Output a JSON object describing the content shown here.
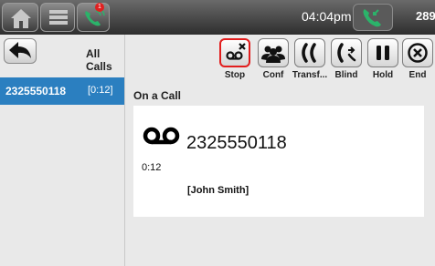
{
  "status_bar": {
    "time": "04:04pm",
    "extension": "289",
    "notification_count": "1",
    "icons": [
      "home-icon",
      "menu-icon",
      "phone-icon",
      "active-call-icon"
    ]
  },
  "left_panel": {
    "back_icon": "back-arrow-icon",
    "title": "All Calls",
    "calls": [
      {
        "number": "2325550118",
        "duration": "[0:12]"
      }
    ]
  },
  "toolbar": {
    "buttons": [
      {
        "label": "Stop",
        "icon": "voicemail-stop-icon",
        "active": true
      },
      {
        "label": "Conf",
        "icon": "conference-icon"
      },
      {
        "label": "Transf...",
        "icon": "transfer-icon"
      },
      {
        "label": "Blind",
        "icon": "blind-transfer-icon"
      },
      {
        "label": "Hold",
        "icon": "hold-icon"
      },
      {
        "label": "End",
        "icon": "end-call-icon"
      }
    ]
  },
  "main": {
    "status": "On a Call",
    "card": {
      "number": "2325550118",
      "duration": "0:12",
      "name": "[John Smith]"
    }
  },
  "colors": {
    "accent": "#2b7fc0",
    "highlight": "#e21d1d",
    "topbar": "#3f3f3f",
    "call_icon": "#2bb36a"
  }
}
